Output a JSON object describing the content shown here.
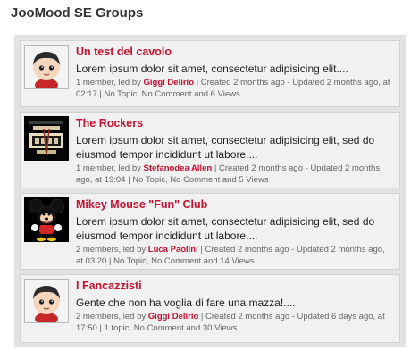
{
  "module": {
    "title": "JooMood SE Groups"
  },
  "colors": {
    "accent": "#c8102e",
    "panel": "#e2e2e2",
    "card": "#f1f1f1"
  },
  "groups": [
    {
      "title": "Un test del cavolo",
      "avatar": "cartoon-boy-avatar-icon",
      "description": "Lorem ipsum dolor sit amet, consectetur adipisicing elit....",
      "meta_prefix": "1 member, led by",
      "leader": "Giggi Delirio",
      "meta_suffix": "| Created 2 months ago - Updated 2 months ago, at 02:17 | No Topic, No Comment and 6 Views"
    },
    {
      "title": "The Rockers",
      "avatar": "we-will-rock-you-poster-icon",
      "description": "Lorem ipsum dolor sit amet, consectetur adipisicing elit, sed do eiusmod tempor incididunt ut labore....",
      "meta_prefix": "1 member, led by",
      "leader": "Stefanodea Allen",
      "meta_suffix": "| Created 2 months ago - Updated 2 months ago, at 19:04 | No Topic, No Comment and 5 Views"
    },
    {
      "title": "Mikey Mouse \"Fun\" Club",
      "avatar": "mickey-mouse-icon",
      "description": "Lorem ipsum dolor sit amet, consectetur adipisicing elit, sed do eiusmod tempor incididunt ut labore....",
      "meta_prefix": "2 members, led by",
      "leader": "Luca Paolini",
      "meta_suffix": "| Created 2 months ago - Updated 2 months ago, at 03:20 | No Topic, No Comment and 14 Views"
    },
    {
      "title": "I Fancazzisti",
      "avatar": "cartoon-boy-avatar-icon",
      "description": "Gente che non ha voglia di fare una mazza!....",
      "meta_prefix": "2 members, led by",
      "leader": "Giggi Delirio",
      "meta_suffix": "| Created 2 months ago - Updated 6 days ago, at 17:50 | 1 topic, No Comment and 30 Views"
    }
  ]
}
